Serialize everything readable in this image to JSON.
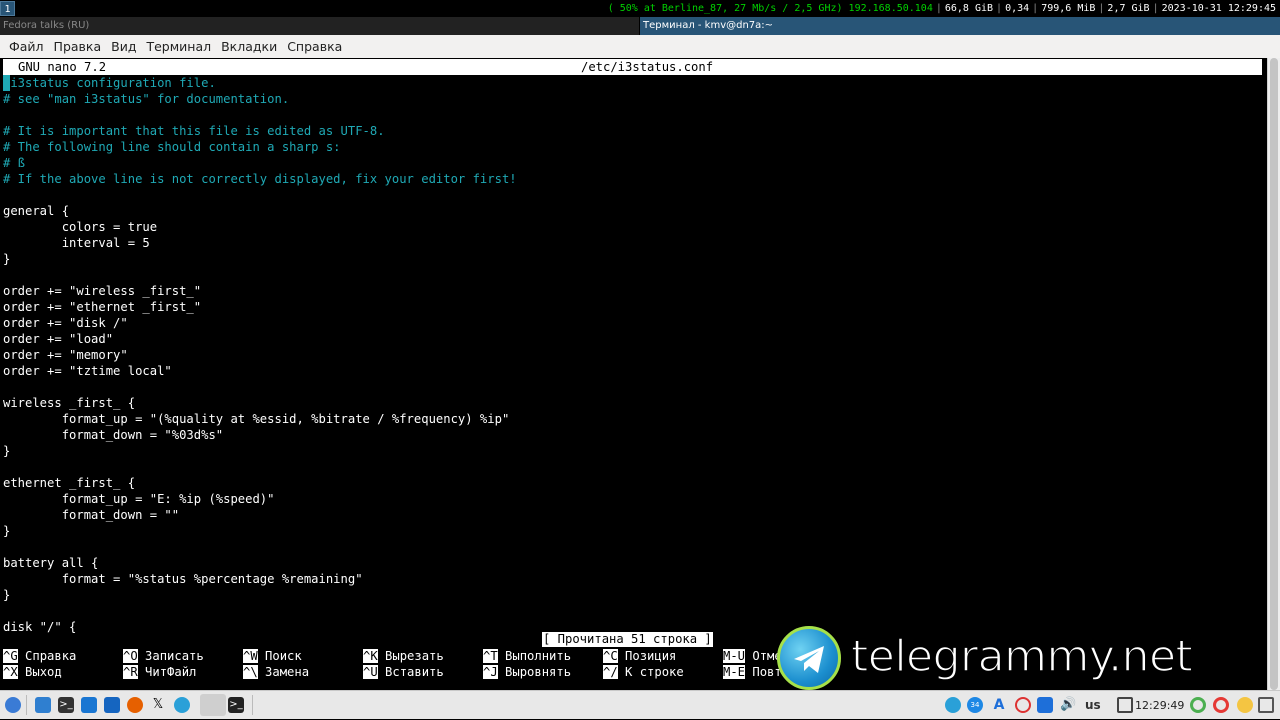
{
  "topbar": {
    "workspace": "1",
    "wifi": "( 50% at Berline_87, 27 Mb/s / 2,5 GHz)",
    "ip": "192.168.50.104",
    "disk": "66,8 GiB",
    "load": "0,34",
    "memory": "799,6 MiB",
    "memory2": "2,7 GiB",
    "datetime": "2023-10-31 12:29:45"
  },
  "windows": {
    "left_title": "Fedora talks (RU)",
    "right_title": "Терминал - kmv@dn7a:~"
  },
  "menu": {
    "items": [
      "Файл",
      "Правка",
      "Вид",
      "Терминал",
      "Вкладки",
      "Справка"
    ]
  },
  "nano": {
    "version": "GNU nano 7.2",
    "filename": "/etc/i3status.conf",
    "message": "[ Прочитана 51 строка ]",
    "lines": [
      {
        "text": " i3status configuration file.",
        "comment": true
      },
      {
        "text": "# see \"man i3status\" for documentation.",
        "comment": true
      },
      {
        "text": "",
        "comment": false
      },
      {
        "text": "# It is important that this file is edited as UTF-8.",
        "comment": true
      },
      {
        "text": "# The following line should contain a sharp s:",
        "comment": true
      },
      {
        "text": "# ß",
        "comment": true
      },
      {
        "text": "# If the above line is not correctly displayed, fix your editor first!",
        "comment": true
      },
      {
        "text": "",
        "comment": false
      },
      {
        "text": "general {",
        "comment": false
      },
      {
        "text": "        colors = true",
        "comment": false
      },
      {
        "text": "        interval = 5",
        "comment": false
      },
      {
        "text": "}",
        "comment": false
      },
      {
        "text": "",
        "comment": false
      },
      {
        "text": "order += \"wireless _first_\"",
        "comment": false
      },
      {
        "text": "order += \"ethernet _first_\"",
        "comment": false
      },
      {
        "text": "order += \"disk /\"",
        "comment": false
      },
      {
        "text": "order += \"load\"",
        "comment": false
      },
      {
        "text": "order += \"memory\"",
        "comment": false
      },
      {
        "text": "order += \"tztime local\"",
        "comment": false
      },
      {
        "text": "",
        "comment": false
      },
      {
        "text": "wireless _first_ {",
        "comment": false
      },
      {
        "text": "        format_up = \"(%quality at %essid, %bitrate / %frequency) %ip\"",
        "comment": false
      },
      {
        "text": "        format_down = \"%03d%s\"",
        "comment": false
      },
      {
        "text": "}",
        "comment": false
      },
      {
        "text": "",
        "comment": false
      },
      {
        "text": "ethernet _first_ {",
        "comment": false
      },
      {
        "text": "        format_up = \"E: %ip (%speed)\"",
        "comment": false
      },
      {
        "text": "        format_down = \"\"",
        "comment": false
      },
      {
        "text": "}",
        "comment": false
      },
      {
        "text": "",
        "comment": false
      },
      {
        "text": "battery all {",
        "comment": false
      },
      {
        "text": "        format = \"%status %percentage %remaining\"",
        "comment": false
      },
      {
        "text": "}",
        "comment": false
      },
      {
        "text": "",
        "comment": false
      },
      {
        "text": "disk \"/\" {",
        "comment": false
      }
    ],
    "shortcuts_row1": [
      {
        "key": "^G",
        "label": "Справка"
      },
      {
        "key": "^O",
        "label": "Записать"
      },
      {
        "key": "^W",
        "label": "Поиск"
      },
      {
        "key": "^K",
        "label": "Вырезать"
      },
      {
        "key": "^T",
        "label": "Выполнить"
      },
      {
        "key": "^C",
        "label": "Позиция"
      },
      {
        "key": "M-U",
        "label": "Отмена"
      }
    ],
    "shortcuts_row2": [
      {
        "key": "^X",
        "label": "Выход"
      },
      {
        "key": "^R",
        "label": "ЧитФайл"
      },
      {
        "key": "^\\",
        "label": "Замена"
      },
      {
        "key": "^U",
        "label": "Вставить"
      },
      {
        "key": "^J",
        "label": "Выровнять"
      },
      {
        "key": "^/",
        "label": "К строке"
      },
      {
        "key": "M-E",
        "label": "Повтор"
      }
    ]
  },
  "watermark": {
    "text": "telegrammy.net",
    "icon": "telegram-logo-icon"
  },
  "panel": {
    "clock": "12:29:49",
    "layout": "us",
    "icons_left": [
      "menu-icon",
      "files-icon",
      "terminal-icon",
      "telegram-icon",
      "calc-icon",
      "firefox-icon",
      "x-icon",
      "telegram-icon",
      "telegram-active-icon",
      "terminal-active-icon"
    ],
    "icons_right": [
      "telegram-tray-icon",
      "badge-34-icon",
      "app-a-icon",
      "redhat-icon",
      "network-icon",
      "volume-icon",
      "clipboard-icon",
      "update-icon",
      "power-icon",
      "weather-icon"
    ]
  }
}
